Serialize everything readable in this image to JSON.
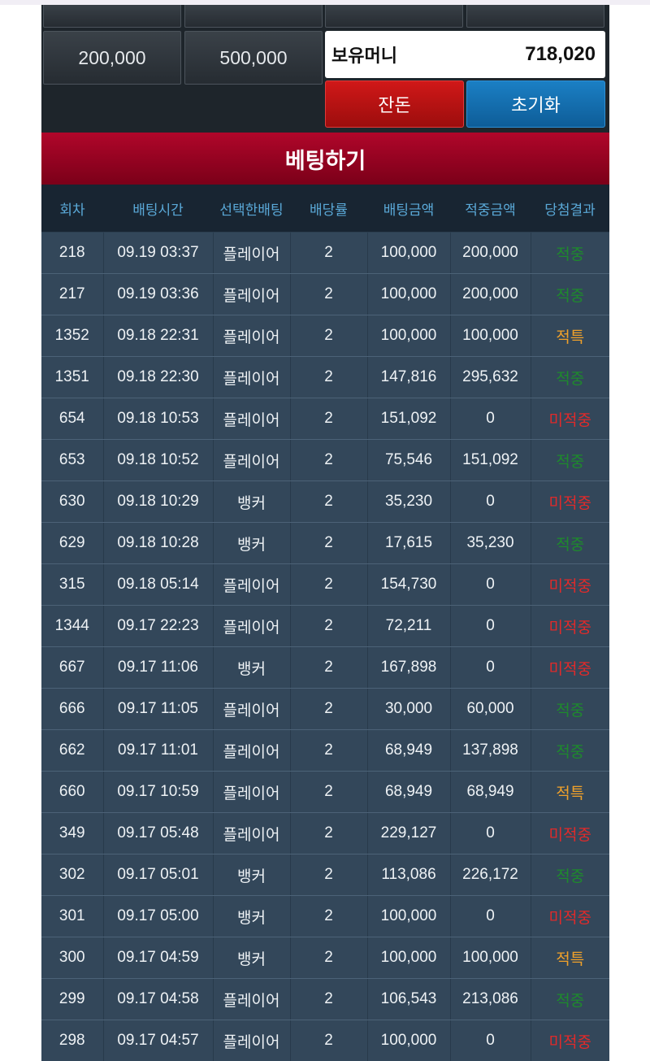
{
  "amount_buttons_top_row": [
    "",
    "",
    "",
    ""
  ],
  "amount_buttons": [
    "200,000",
    "500,000"
  ],
  "money": {
    "label": "보유머니",
    "value": "718,020"
  },
  "actions": {
    "balance_label": "잔돈",
    "reset_label": "초기화"
  },
  "bet_header": "베팅하기",
  "columns": [
    "회차",
    "배팅시간",
    "선택한배팅",
    "배당률",
    "배팅금액",
    "적중금액",
    "당첨결과"
  ],
  "colors": {
    "win": "#1e8a2c",
    "tie": "#f0a12a",
    "lose": "#e02a2a"
  },
  "rows": [
    {
      "round": "218",
      "time": "09.19 03:37",
      "pick": "플레이어",
      "odds": "2",
      "bet": "100,000",
      "payout": "200,000",
      "result": "적중",
      "status": "win"
    },
    {
      "round": "217",
      "time": "09.19 03:36",
      "pick": "플레이어",
      "odds": "2",
      "bet": "100,000",
      "payout": "200,000",
      "result": "적중",
      "status": "win"
    },
    {
      "round": "1352",
      "time": "09.18 22:31",
      "pick": "플레이어",
      "odds": "2",
      "bet": "100,000",
      "payout": "100,000",
      "result": "적특",
      "status": "tie"
    },
    {
      "round": "1351",
      "time": "09.18 22:30",
      "pick": "플레이어",
      "odds": "2",
      "bet": "147,816",
      "payout": "295,632",
      "result": "적중",
      "status": "win"
    },
    {
      "round": "654",
      "time": "09.18 10:53",
      "pick": "플레이어",
      "odds": "2",
      "bet": "151,092",
      "payout": "0",
      "result": "미적중",
      "status": "lose"
    },
    {
      "round": "653",
      "time": "09.18 10:52",
      "pick": "플레이어",
      "odds": "2",
      "bet": "75,546",
      "payout": "151,092",
      "result": "적중",
      "status": "win"
    },
    {
      "round": "630",
      "time": "09.18 10:29",
      "pick": "뱅커",
      "odds": "2",
      "bet": "35,230",
      "payout": "0",
      "result": "미적중",
      "status": "lose"
    },
    {
      "round": "629",
      "time": "09.18 10:28",
      "pick": "뱅커",
      "odds": "2",
      "bet": "17,615",
      "payout": "35,230",
      "result": "적중",
      "status": "win"
    },
    {
      "round": "315",
      "time": "09.18 05:14",
      "pick": "플레이어",
      "odds": "2",
      "bet": "154,730",
      "payout": "0",
      "result": "미적중",
      "status": "lose"
    },
    {
      "round": "1344",
      "time": "09.17 22:23",
      "pick": "플레이어",
      "odds": "2",
      "bet": "72,211",
      "payout": "0",
      "result": "미적중",
      "status": "lose"
    },
    {
      "round": "667",
      "time": "09.17 11:06",
      "pick": "뱅커",
      "odds": "2",
      "bet": "167,898",
      "payout": "0",
      "result": "미적중",
      "status": "lose"
    },
    {
      "round": "666",
      "time": "09.17 11:05",
      "pick": "플레이어",
      "odds": "2",
      "bet": "30,000",
      "payout": "60,000",
      "result": "적중",
      "status": "win"
    },
    {
      "round": "662",
      "time": "09.17 11:01",
      "pick": "플레이어",
      "odds": "2",
      "bet": "68,949",
      "payout": "137,898",
      "result": "적중",
      "status": "win"
    },
    {
      "round": "660",
      "time": "09.17 10:59",
      "pick": "플레이어",
      "odds": "2",
      "bet": "68,949",
      "payout": "68,949",
      "result": "적특",
      "status": "tie"
    },
    {
      "round": "349",
      "time": "09.17 05:48",
      "pick": "플레이어",
      "odds": "2",
      "bet": "229,127",
      "payout": "0",
      "result": "미적중",
      "status": "lose"
    },
    {
      "round": "302",
      "time": "09.17 05:01",
      "pick": "뱅커",
      "odds": "2",
      "bet": "113,086",
      "payout": "226,172",
      "result": "적중",
      "status": "win"
    },
    {
      "round": "301",
      "time": "09.17 05:00",
      "pick": "뱅커",
      "odds": "2",
      "bet": "100,000",
      "payout": "0",
      "result": "미적중",
      "status": "lose"
    },
    {
      "round": "300",
      "time": "09.17 04:59",
      "pick": "뱅커",
      "odds": "2",
      "bet": "100,000",
      "payout": "100,000",
      "result": "적특",
      "status": "tie"
    },
    {
      "round": "299",
      "time": "09.17 04:58",
      "pick": "플레이어",
      "odds": "2",
      "bet": "106,543",
      "payout": "213,086",
      "result": "적중",
      "status": "win"
    },
    {
      "round": "298",
      "time": "09.17 04:57",
      "pick": "플레이어",
      "odds": "2",
      "bet": "100,000",
      "payout": "0",
      "result": "미적중",
      "status": "lose"
    }
  ]
}
